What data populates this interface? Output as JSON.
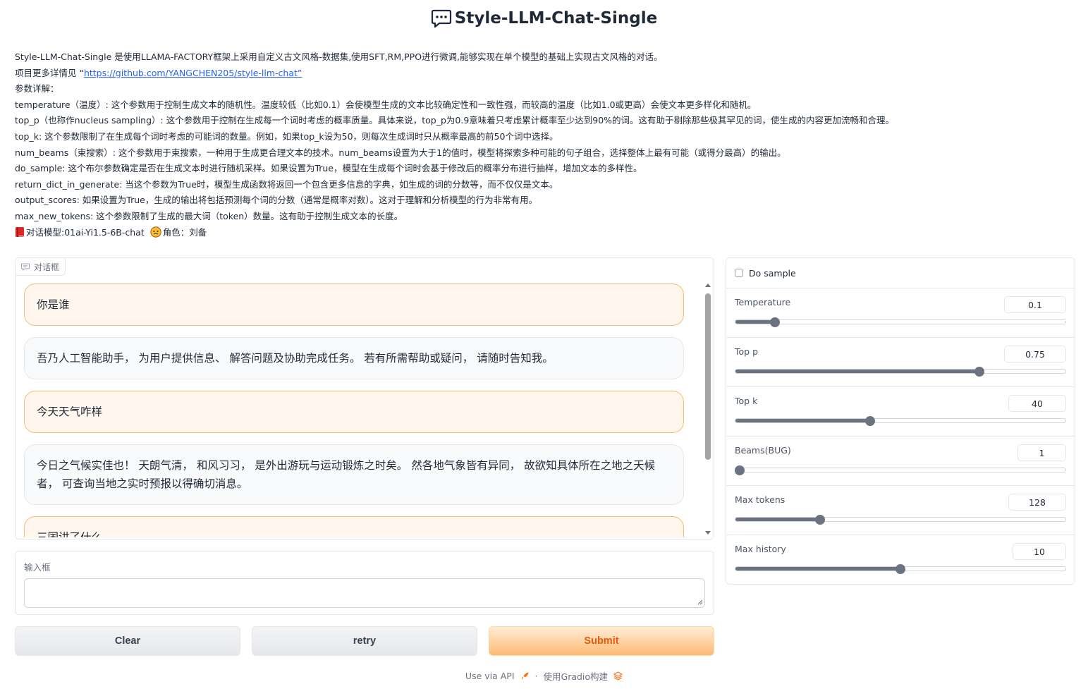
{
  "header": {
    "title": "Style-LLM-Chat-Single",
    "icon": "chat-bubble-icon"
  },
  "description": {
    "line1": "Style-LLM-Chat-Single 是使用LLAMA-FACTORY框架上采用自定义古文风格-数据集,使用SFT,RM,PPO进行微调,能够实现在单个模型的基础上实现古文风格的对话。",
    "line2_prefix": "项目更多详情见 “",
    "line2_link": "https://github.com/YANGCHEN205/style-llm-chat”",
    "line3": "参数详解：",
    "line4": "temperature（温度）: 这个参数用于控制生成文本的随机性。温度较低（比如0.1）会使模型生成的文本比较确定性和一致性强，而较高的温度（比如1.0或更高）会使文本更多样化和随机。",
    "line5": "top_p（也称作nucleus sampling）: 这个参数用于控制在生成每一个词时考虑的概率质量。具体来说，top_p为0.9意味着只考虑累计概率至少达到90%的词。这有助于剔除那些极其罕见的词，使生成的内容更加流畅和合理。",
    "line6": "top_k: 这个参数限制了在生成每个词时考虑的可能词的数量。例如，如果top_k设为50，则每次生成词时只从概率最高的前50个词中选择。",
    "line7": "num_beams（束搜索）: 这个参数用于束搜索，一种用于生成更合理文本的技术。num_beams设置为大于1的值时，模型将探索多种可能的句子组合，选择整体上最有可能（或得分最高）的输出。",
    "line8": "do_sample: 这个布尔参数确定是否在生成文本时进行随机采样。如果设置为True，模型在生成每个词时会基于修改后的概率分布进行抽样，增加文本的多样性。",
    "line9": "return_dict_in_generate: 当这个参数为True时，模型生成函数将返回一个包含更多信息的字典，如生成的词的分数等，而不仅仅是文本。",
    "line10": "output_scores: 如果设置为True，生成的输出将包括预测每个词的分数（通常是概率对数）。这对于理解和分析模型的行为非常有用。",
    "line11": "max_new_tokens: 这个参数限制了生成的最大词（token）数量。这有助于控制生成文本的长度。",
    "line12_model": "对话模型:01ai-Yi1.5-6B-chat",
    "line12_role": "角色：刘备",
    "book_icon": "red-book-icon",
    "face_icon": "face-emoji-icon"
  },
  "chat": {
    "label": "对话框",
    "messages": [
      {
        "role": "user",
        "text": "你是谁"
      },
      {
        "role": "bot",
        "text": "吾乃人工智能助手， 为用户提供信息、 解答问题及协助完成任务。 若有所需帮助或疑问， 请随时告知我。"
      },
      {
        "role": "user",
        "text": "今天天气咋样"
      },
      {
        "role": "bot",
        "text": "今日之气候实佳也！ 天朗气清， 和风习习， 是外出游玩与运动锻炼之时矣。 然各地气象皆有异同， 故欲知具体所在之地之天候者， 可查询当地之实时预报以得确切消息。"
      },
      {
        "role": "user",
        "text": "三国讲了什么"
      }
    ]
  },
  "input": {
    "label": "输入框",
    "value": "",
    "placeholder": ""
  },
  "buttons": {
    "clear": "Clear",
    "retry": "retry",
    "submit": "Submit"
  },
  "settings": {
    "do_sample_label": "Do sample",
    "do_sample_checked": false,
    "sliders": [
      {
        "label": "Temperature",
        "value": "0.1",
        "fraction": 0.11
      },
      {
        "label": "Top p",
        "value": "0.75",
        "fraction": 0.745
      },
      {
        "label": "Top k",
        "value": "40",
        "fraction": 0.405
      },
      {
        "label": "Beams(BUG)",
        "value": "1",
        "fraction": 0.0
      },
      {
        "label": "Max tokens",
        "value": "128",
        "fraction": 0.25
      },
      {
        "label": "Max history",
        "value": "10",
        "fraction": 0.5
      }
    ]
  },
  "footer": {
    "api": "Use via API",
    "sep": "·",
    "built": "使用Gradio构建"
  },
  "colors": {
    "accent": "#ea580c",
    "user_bubble": "#fff7ed",
    "slider": "#6b7280"
  }
}
